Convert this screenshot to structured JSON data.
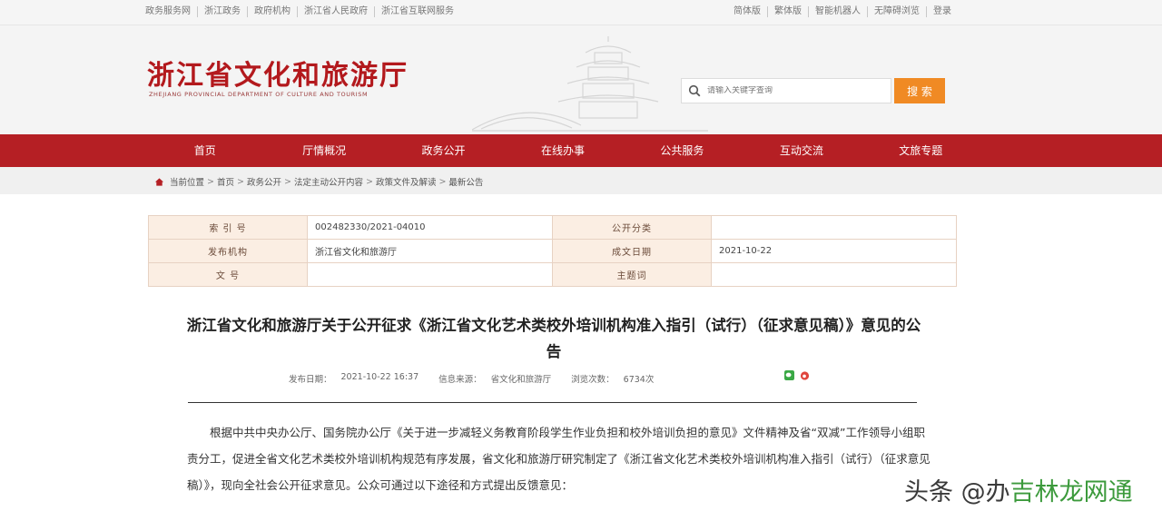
{
  "topbar": {
    "left_links": [
      "政务服务网",
      "浙江政务",
      "政府机构",
      "浙江省人民政府",
      "浙江省互联网服务"
    ],
    "right_links": [
      "简体版",
      "繁体版",
      "智能机器人",
      "无障碍浏览",
      "登录"
    ]
  },
  "header": {
    "title": "浙江省文化和旅游厅",
    "subtitle": "ZHEJIANG PROVINCIAL DEPARTMENT OF CULTURE AND TOURISM",
    "search_placeholder": "请输入关键字查询",
    "search_button": "搜 索"
  },
  "nav": {
    "items": [
      "首页",
      "厅情概况",
      "政务公开",
      "在线办事",
      "公共服务",
      "互动交流",
      "文旅专题"
    ]
  },
  "breadcrumb": {
    "items": [
      "当前位置",
      "首页",
      "政务公开",
      "法定主动公开内容",
      "政策文件及解读",
      "最新公告"
    ],
    "separator": ">"
  },
  "meta_table": {
    "rows": [
      {
        "label1": "索 引 号",
        "value1": "002482330/2021-04010",
        "label2": "公开分类",
        "value2": ""
      },
      {
        "label1": "发布机构",
        "value1": "浙江省文化和旅游厅",
        "label2": "成文日期",
        "value2": "2021-10-22"
      },
      {
        "label1": "文 号",
        "value1": "",
        "label2": "主题词",
        "value2": ""
      }
    ]
  },
  "article": {
    "title": "浙江省文化和旅游厅关于公开征求《浙江省文化艺术类校外培训机构准入指引（试行）（征求意见稿）》意见的公告",
    "publish_label": "发布日期：",
    "publish_date": "2021-10-22 16:37",
    "source_label": "信息来源：",
    "source": "省文化和旅游厅",
    "views_label": "浏览次数：",
    "views": "6734次",
    "body": "根据中共中央办公厅、国务院办公厅《关于进一步减轻义务教育阶段学生作业负担和校外培训负担的意见》文件精神及省“双减”工作领导小组职责分工，促进全省文化艺术类校外培训机构规范有序发展，省文化和旅游厅研究制定了《浙江省文化艺术类校外培训机构准入指引（试行）（征求意见稿）》，现向全社会公开征求意见。公众可通过以下途径和方式提出反馈意见："
  },
  "watermark": {
    "text": "头条 @办",
    "overlay": "吉林龙网通"
  },
  "colors": {
    "brand_red": "#b51f24",
    "search_orange": "#f08a24",
    "table_label_bg": "#fbeee3"
  }
}
